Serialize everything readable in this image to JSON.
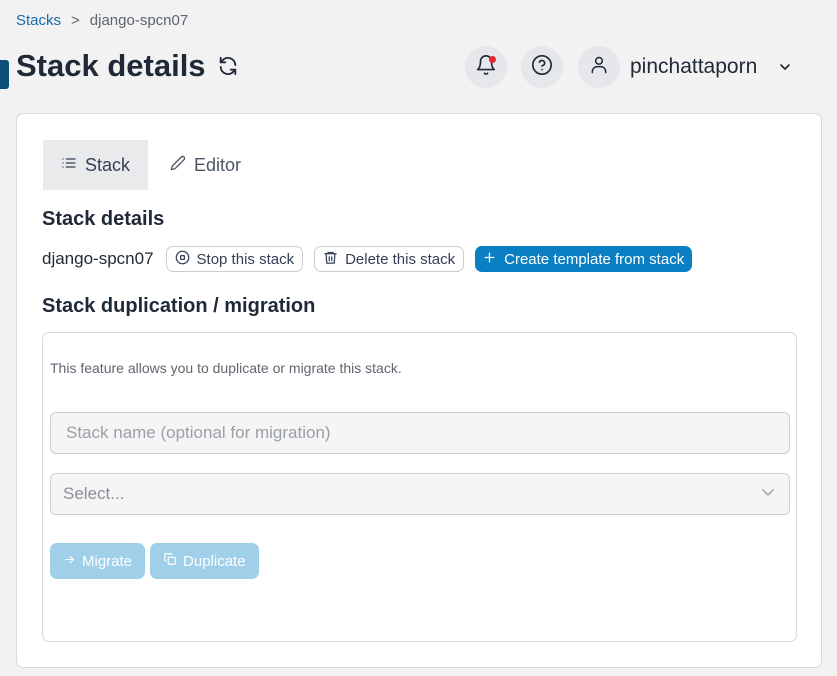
{
  "breadcrumb": {
    "parent": "Stacks",
    "separator": ">",
    "current": "django-spcn07"
  },
  "header": {
    "title": "Stack details",
    "username": "pinchattaporn"
  },
  "tabs": [
    {
      "label": "Stack"
    },
    {
      "label": "Editor"
    }
  ],
  "details": {
    "heading": "Stack details",
    "stack_name": "django-spcn07",
    "stop_label": "Stop this stack",
    "delete_label": "Delete this stack",
    "template_label": "Create template from stack"
  },
  "duplication": {
    "heading": "Stack duplication / migration",
    "description": "This feature allows you to duplicate or migrate this stack.",
    "name_placeholder": "Stack name (optional for migration)",
    "select_placeholder": "Select...",
    "migrate_label": "Migrate",
    "duplicate_label": "Duplicate"
  },
  "colors": {
    "accent": "#0b7fc4",
    "link": "#1b6aa5",
    "disabled_button": "#9fcfe9",
    "notification_dot": "#e5252a"
  }
}
